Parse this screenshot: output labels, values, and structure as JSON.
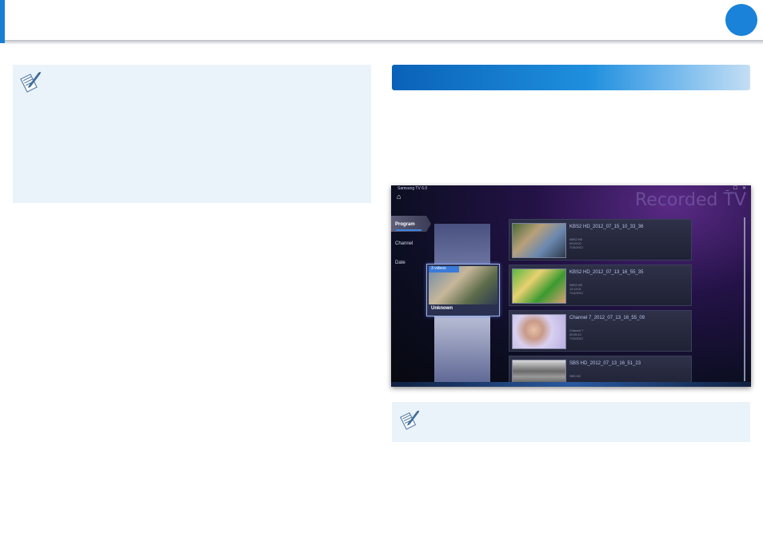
{
  "tv_app": {
    "window_title": "Samsung TV 6.0",
    "window_controls": "_ ☐ ✕",
    "home_glyph": "⌂",
    "header_title": "Recorded TV",
    "nav": [
      {
        "label": "Program",
        "selected": true
      },
      {
        "label": "Channel",
        "selected": false
      },
      {
        "label": "Date",
        "selected": false
      }
    ],
    "folder": {
      "count_label": "3 videos",
      "name": "Unknown"
    },
    "recordings": [
      {
        "name": "KBS2 HD_2012_07_15_10_33_36",
        "meta": "KBS2 HD\n00:09:02\n7/15/2012"
      },
      {
        "name": "KBS2 HD_2012_07_13_16_55_35",
        "meta": "KBS2 HD\n12:13:01\n7/14/2012"
      },
      {
        "name": "Channel 7_2012_07_13_16_55_09",
        "meta": "Channel 7\n00:05:12\n7/13/2012"
      },
      {
        "name": "SBS HD_2012_07_13_16_51_23",
        "meta": "SBS HD"
      }
    ]
  },
  "colors": {
    "accent": "#1a7fd4",
    "note_background": "#eaf2fa",
    "section_bar_start": "#0a62b8",
    "tv_title": "#6b4c98"
  },
  "icons": {
    "note": "pencil-note-icon",
    "home": "home-icon"
  }
}
